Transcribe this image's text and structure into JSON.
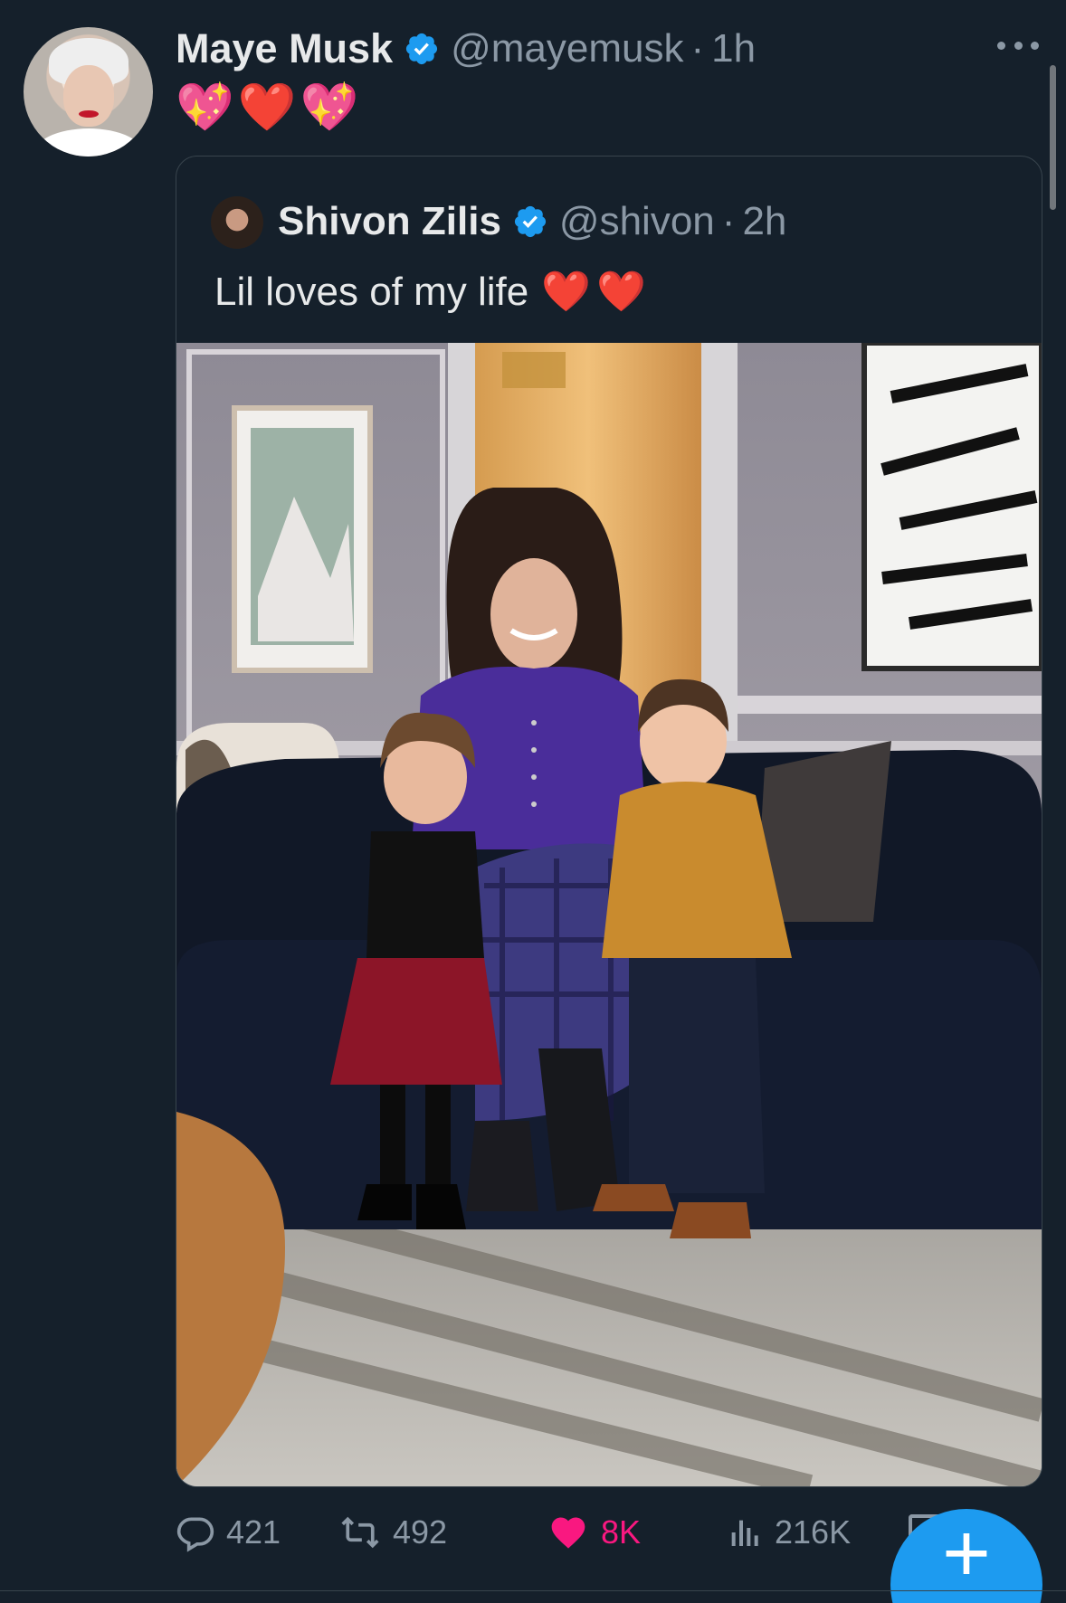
{
  "tweet": {
    "author": {
      "display_name": "Maye Musk",
      "handle": "@mayemusk",
      "verified": true
    },
    "separator": "·",
    "time": "1h",
    "text": "💖❤️💖",
    "more_icon": "more-horizontal-icon",
    "quoted": {
      "author": {
        "display_name": "Shivon Zilis",
        "handle": "@shivon",
        "verified": true
      },
      "separator": "·",
      "time": "2h",
      "text": "Lil loves of my life",
      "text_emoji": "❤️❤️",
      "photo_icon": "family-photo"
    },
    "actions": {
      "replies": "421",
      "reposts": "492",
      "likes": "8K",
      "views": "216K"
    }
  },
  "colors": {
    "background": "#15202b",
    "primary_text": "#e7e9ea",
    "secondary_text": "#8b98a5",
    "verified_blue": "#1d9bf0",
    "like_pink": "#f91880",
    "border": "#38444d"
  },
  "fab": {
    "icon": "plus-icon",
    "label": "+"
  }
}
